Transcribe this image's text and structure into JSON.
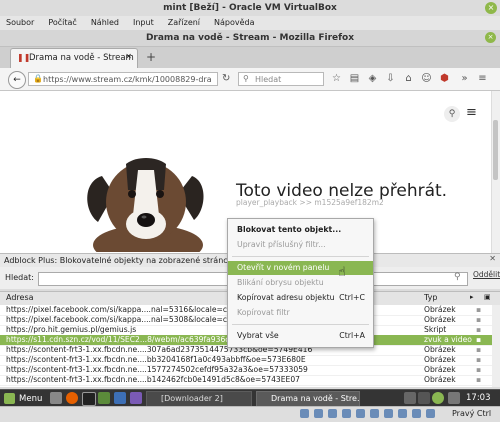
{
  "vbox": {
    "title": "mint [Beží] - Oracle VM VirtualBox",
    "menu": [
      "Soubor",
      "Počítač",
      "Náhled",
      "Input",
      "Zařízení",
      "Nápověda"
    ],
    "host_key": "Pravý Ctrl"
  },
  "firefox": {
    "window_title": "Drama na vodě - Stream - Mozilla Firefox",
    "tab_title": "Drama na vodě - Stream",
    "url": "https://www.stream.cz/kmk/10008829-dra",
    "search_placeholder": "Hledat"
  },
  "page": {
    "message": "Toto video nelze přehrát.",
    "sub": "player_playback >> m1525a9ef182m2"
  },
  "context_menu": {
    "items": [
      {
        "label": "Blokovat tento objekt...",
        "bold": true
      },
      {
        "label": "Upravit příslušný filtr...",
        "disabled": true
      },
      {
        "label": "Otevřít v novém panelu",
        "hover": true
      },
      {
        "label": "Blikání obrysu objektu",
        "disabled": true
      },
      {
        "label": "Kopírovat adresu objektu",
        "shortcut": "Ctrl+C"
      },
      {
        "label": "Kopírovat filtr",
        "disabled": true
      },
      {
        "label": "Vybrat vše",
        "shortcut": "Ctrl+A"
      }
    ]
  },
  "adblock": {
    "title": "Adblock Plus: Blokovatelné objekty na zobrazené stránce",
    "filter_label": "Hledat:",
    "hide_label": "Oddělit",
    "col_address": "Adresa",
    "col_type": "Typ",
    "rows": [
      {
        "addr": "https://pixel.facebook.com/si/kappa....nal=5316&locale=cs_CZ&lsd=",
        "type": "Obrázek"
      },
      {
        "addr": "https://pixel.facebook.com/si/kappa....nal=5308&locale=cs_CZ&lsd=",
        "type": "Obrázek"
      },
      {
        "addr": "https://pro.hit.gemius.pl/gemius.js",
        "type": "Skript"
      },
      {
        "addr": "https://s11.cdn.szn.cz/vod/11/SEC2...8/webm/ac639fa936c1711_480p.webm",
        "type": "zvuk a video",
        "selected": true
      },
      {
        "addr": "https://scontent-frt3-1.xx.fbcdn.ne....307a6ad2373514475733cb&oe=5749E416",
        "type": "Obrázek"
      },
      {
        "addr": "https://scontent-frt3-1.xx.fbcdn.ne....bb3204168f1a0c493abbff&oe=573E680E",
        "type": "Obrázek"
      },
      {
        "addr": "https://scontent-frt3-1.xx.fbcdn.ne....1577274502cefdf95a32a3&oe=57333059",
        "type": "Obrázek"
      },
      {
        "addr": "https://scontent-frt3-1.xx.fbcdn.ne....b142462fcb0e1491d5c8&oe=5743EE07",
        "type": "Obrázek"
      }
    ]
  },
  "taskbar": {
    "menu_label": "Menu",
    "task1": "[Downloader 2]",
    "task2": "Drama na vodě - Stre...",
    "clock": "17:03"
  },
  "colors": {
    "accent": "#8ab752",
    "taskbar": "#343434"
  }
}
